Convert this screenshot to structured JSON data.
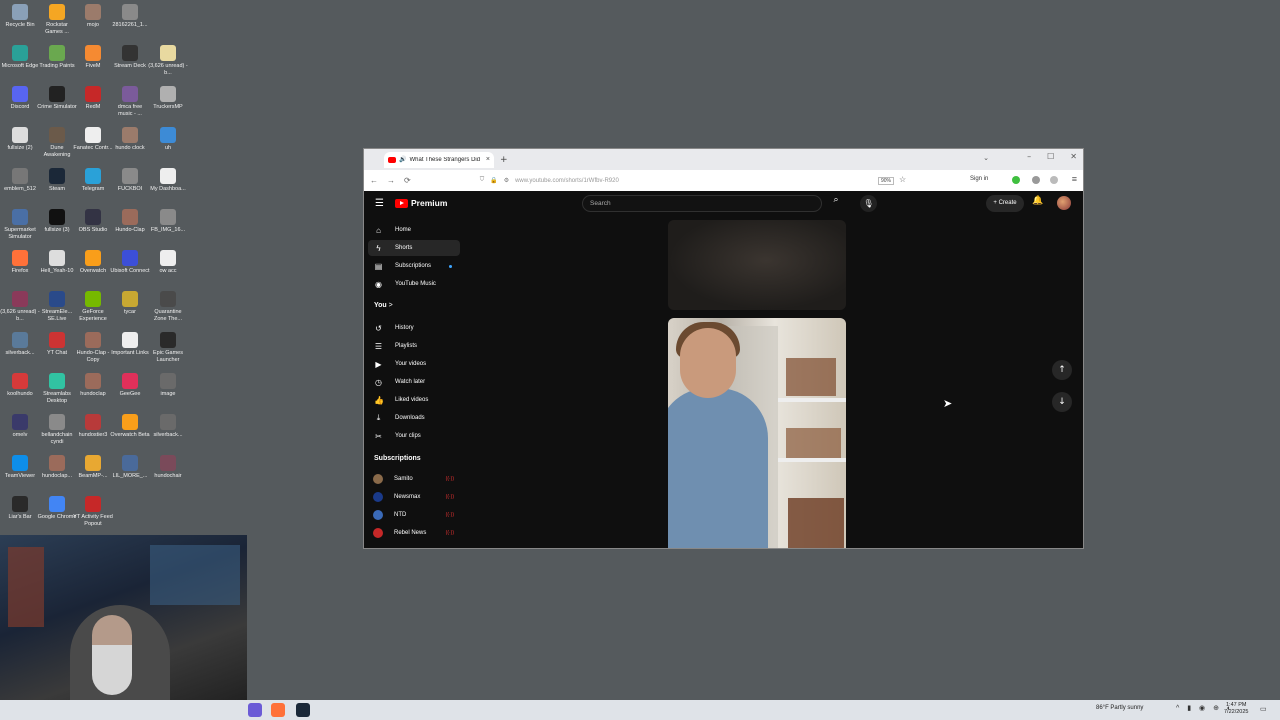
{
  "desktop": {
    "icons": [
      {
        "label": "Recycle Bin",
        "color": "#8aa0b8"
      },
      {
        "label": "Rockstar Games ...",
        "color": "#f5a623"
      },
      {
        "label": "mojo",
        "color": "#9b7b6b"
      },
      {
        "label": "28162261_1...",
        "color": "#8a8a8a"
      },
      {
        "label": "Microsoft Edge",
        "color": "#2aa198"
      },
      {
        "label": "Trading Paints",
        "color": "#6aa84f"
      },
      {
        "label": "FiveM",
        "color": "#f58a32"
      },
      {
        "label": "Stream Deck",
        "color": "#333333"
      },
      {
        "label": "(3,626 unread) - b...",
        "color": "#e8d9a0"
      },
      {
        "label": "Discord",
        "color": "#5865f2"
      },
      {
        "label": "Crime Simulator",
        "color": "#222222"
      },
      {
        "label": "RedM",
        "color": "#c62828"
      },
      {
        "label": "dmca free music - ...",
        "color": "#7b5b9b"
      },
      {
        "label": "TruckersMP",
        "color": "#b0b0b0"
      },
      {
        "label": "fullsize (2)",
        "color": "#dddddd"
      },
      {
        "label": "Dune Awakening",
        "color": "#6b5a4a"
      },
      {
        "label": "Fanatec Contr...",
        "color": "#eeeeee"
      },
      {
        "label": "hundo clock",
        "color": "#9b7b6b"
      },
      {
        "label": "uh",
        "color": "#3d8bd6"
      },
      {
        "label": "emblem_512",
        "color": "#777777"
      },
      {
        "label": "Steam",
        "color": "#1b2838"
      },
      {
        "label": "Telegram",
        "color": "#2aa1d8"
      },
      {
        "label": "FUCKBOI",
        "color": "#8a8a8a"
      },
      {
        "label": "My Dashboa...",
        "color": "#eeeeee"
      },
      {
        "label": "Supermarket Simulator",
        "color": "#4a6fa5"
      },
      {
        "label": "fullsize (3)",
        "color": "#111111"
      },
      {
        "label": "OBS Studio",
        "color": "#333344"
      },
      {
        "label": "Hundo-Clap",
        "color": "#9b6b5b"
      },
      {
        "label": "FB_IMG_16...",
        "color": "#8a8a8a"
      },
      {
        "label": "Firefox",
        "color": "#ff7139"
      },
      {
        "label": "Hell_Yeah-10",
        "color": "#dddddd"
      },
      {
        "label": "Overwatch",
        "color": "#f99e1a"
      },
      {
        "label": "Ubisoft Connect",
        "color": "#3c4fd8"
      },
      {
        "label": "ow acc",
        "color": "#eeeeee"
      },
      {
        "label": "(3,626 unread) - b...",
        "color": "#8a3a5a"
      },
      {
        "label": "StreamEle... SE.Live",
        "color": "#2a4a8a"
      },
      {
        "label": "GeForce Experience",
        "color": "#76b900"
      },
      {
        "label": "tycar",
        "color": "#c8a832"
      },
      {
        "label": "Quarantine Zone The...",
        "color": "#4a4a4a"
      },
      {
        "label": "silverback...",
        "color": "#5a7a9a"
      },
      {
        "label": "YT Chat",
        "color": "#cc3333"
      },
      {
        "label": "Hundo-Clap - Copy",
        "color": "#9b6b5b"
      },
      {
        "label": "Important Links",
        "color": "#eeeeee"
      },
      {
        "label": "Epic Games Launcher",
        "color": "#2a2a2a"
      },
      {
        "label": "koolhundo",
        "color": "#d63a3a"
      },
      {
        "label": "Streamlabs Desktop",
        "color": "#31c3a2"
      },
      {
        "label": "hundoclap",
        "color": "#9b6b5b"
      },
      {
        "label": "GeeGee",
        "color": "#e0305a"
      },
      {
        "label": "image",
        "color": "#6a6a6a"
      },
      {
        "label": "omelv",
        "color": "#3a3a6a"
      },
      {
        "label": "bellandchain cyndi",
        "color": "#8a8a8a"
      },
      {
        "label": "hundostier3",
        "color": "#b83a3a"
      },
      {
        "label": "Overwatch Beta",
        "color": "#f99e1a"
      },
      {
        "label": "silverback...",
        "color": "#6a6a6a"
      },
      {
        "label": "TeamViewer",
        "color": "#0e8ee9"
      },
      {
        "label": "hundoclap...",
        "color": "#9b6b5b"
      },
      {
        "label": "BeamMP-...",
        "color": "#e8a832"
      },
      {
        "label": "LIL_MORE_...",
        "color": "#4a6a9a"
      },
      {
        "label": "hundochair",
        "color": "#7a4a5a"
      },
      {
        "label": "Liar's Bar",
        "color": "#2a2a2a"
      },
      {
        "label": "Google Chrome",
        "color": "#4285f4"
      },
      {
        "label": "YT Activity Feed Popout",
        "color": "#c62828"
      }
    ]
  },
  "browser": {
    "tab_title": "What These Strangers Did",
    "tab_close": "×",
    "new_tab": "+",
    "tab_dropdown": "⌄",
    "win_minimize": "–",
    "win_maximize": "☐",
    "win_close": "✕",
    "nav_back": "←",
    "nav_forward": "→",
    "nav_reload": "⟳",
    "url": "www.youtube.com/shorts/1rWfbv-R920",
    "zoom": "90%",
    "bookmark_star": "☆",
    "signin": "Sign in",
    "menu": "≡"
  },
  "youtube": {
    "logo_text": "Premium",
    "search_placeholder": "Search",
    "search_icon": "⌕",
    "mic_icon": "🎙",
    "create_label": "+ Create",
    "bell_icon": "🔔",
    "sidebar_main": [
      {
        "label": "Home",
        "icon": "⌂"
      },
      {
        "label": "Shorts",
        "icon": "ϟ"
      },
      {
        "label": "Subscriptions",
        "icon": "▤"
      },
      {
        "label": "YouTube Music",
        "icon": "◉"
      }
    ],
    "you_heading": "You",
    "you_chevron": ">",
    "sidebar_you": [
      {
        "label": "History",
        "icon": "↺"
      },
      {
        "label": "Playlists",
        "icon": "☰"
      },
      {
        "label": "Your videos",
        "icon": "▶"
      },
      {
        "label": "Watch later",
        "icon": "◷"
      },
      {
        "label": "Liked videos",
        "icon": "👍"
      },
      {
        "label": "Downloads",
        "icon": "⤓"
      },
      {
        "label": "Your clips",
        "icon": "✂"
      }
    ],
    "subscriptions_heading": "Subscriptions",
    "subscriptions": [
      {
        "label": "Samito",
        "color": "#8a6a4a"
      },
      {
        "label": "Newsmax",
        "color": "#1a3a8a"
      },
      {
        "label": "NTD",
        "color": "#3a6ab8"
      },
      {
        "label": "Rebel News",
        "color": "#c62828"
      }
    ],
    "nav_up": "↑",
    "nav_down": "↓"
  },
  "taskbar": {
    "apps": [
      {
        "name": "app-1",
        "color": "#6b5bd6"
      },
      {
        "name": "app-2",
        "color": "#ff7139"
      },
      {
        "name": "app-3",
        "color": "#1b2838"
      }
    ],
    "weather": "86°F  Partly sunny",
    "tray": "^ ▮ ◉ ⊕ ◐",
    "time": "1:47 PM",
    "date": "7/22/2025",
    "notification": "▭"
  }
}
